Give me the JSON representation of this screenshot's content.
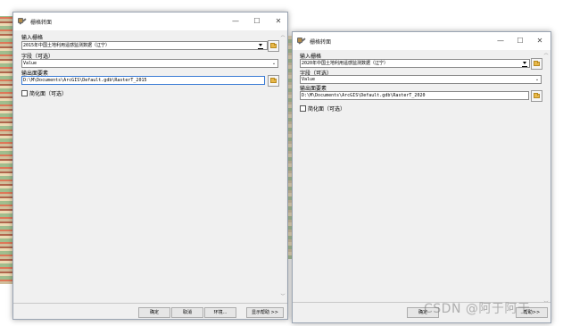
{
  "left_dialog": {
    "title": "栅格转面",
    "controls": {
      "minimize": "—",
      "maximize": "☐",
      "close": "✕"
    },
    "input_raster_label": "输入栅格",
    "input_raster_value": "2015年中国土地利用遥感监测数据（辽宁）",
    "field_label": "字段（可选）",
    "field_value": "Value",
    "output_label": "输出面要素",
    "output_value": "D:\\M\\Documents\\ArcGIS\\Default.gdb\\RasterT_2015",
    "simplify_label": "简化面（可选）",
    "buttons": {
      "ok": "确定",
      "cancel": "取消",
      "env": "环境...",
      "help": "显示帮助 >>"
    }
  },
  "right_dialog": {
    "title": "栅格转面",
    "controls": {
      "minimize": "—",
      "maximize": "☐",
      "close": "✕"
    },
    "input_raster_label": "输入栅格",
    "input_raster_value": "2020年中国土地利用遥感监测数据（辽宁）",
    "field_label": "字段（可选）",
    "field_value": "Value",
    "output_label": "输出面要素",
    "output_value": "D:\\M\\Documents\\ArcGIS\\Default.gdb\\RasterT_2020",
    "simplify_label": "简化面（可选）",
    "buttons": {
      "ok": "确定",
      "help": "帮助>>"
    }
  },
  "watermark": "CSDN @阿于阿于"
}
